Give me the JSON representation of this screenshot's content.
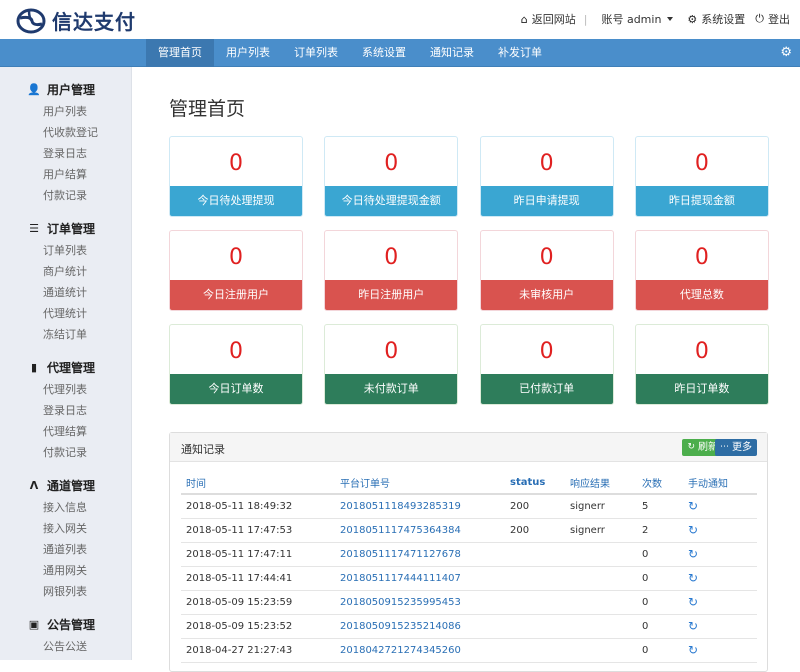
{
  "header": {
    "brand": "信达支付",
    "home_link": "返回网站",
    "account_label": "账号 admin",
    "settings_link": "系统设置",
    "logout_link": "登出"
  },
  "nav": {
    "items": [
      {
        "label": "管理首页",
        "active": true
      },
      {
        "label": "用户列表",
        "active": false
      },
      {
        "label": "订单列表",
        "active": false
      },
      {
        "label": "系统设置",
        "active": false
      },
      {
        "label": "通知记录",
        "active": false
      },
      {
        "label": "补发订单",
        "active": false
      }
    ]
  },
  "sidebar": {
    "groups": [
      {
        "title": "用户管理",
        "icon": "user-icon",
        "items": [
          "用户列表",
          "代收款登记",
          "登录日志",
          "用户结算",
          "付款记录"
        ]
      },
      {
        "title": "订单管理",
        "icon": "list-icon",
        "items": [
          "订单列表",
          "商户统计",
          "通道统计",
          "代理统计",
          "冻结订单"
        ]
      },
      {
        "title": "代理管理",
        "icon": "file-icon",
        "items": [
          "代理列表",
          "登录日志",
          "代理结算",
          "付款记录"
        ]
      },
      {
        "title": "通道管理",
        "icon": "road-icon",
        "items": [
          "接入信息",
          "接入网关",
          "通道列表",
          "通用网关",
          "网银列表"
        ]
      },
      {
        "title": "公告管理",
        "icon": "notice-icon",
        "items": [
          "公告公送"
        ]
      }
    ]
  },
  "main": {
    "title": "管理首页",
    "colors": {
      "blue": "#3aa6d2",
      "red": "#d9534f",
      "green": "#2e7d5b",
      "number": "#e02020"
    },
    "cards": [
      {
        "value": "0",
        "label": "今日待处理提现",
        "color": "blue"
      },
      {
        "value": "0",
        "label": "今日待处理提现金额",
        "color": "blue"
      },
      {
        "value": "0",
        "label": "昨日申请提现",
        "color": "blue"
      },
      {
        "value": "0",
        "label": "昨日提现金额",
        "color": "blue"
      },
      {
        "value": "0",
        "label": "今日注册用户",
        "color": "red"
      },
      {
        "value": "0",
        "label": "昨日注册用户",
        "color": "red"
      },
      {
        "value": "0",
        "label": "未审核用户",
        "color": "red"
      },
      {
        "value": "0",
        "label": "代理总数",
        "color": "red"
      },
      {
        "value": "0",
        "label": "今日订单数",
        "color": "green"
      },
      {
        "value": "0",
        "label": "未付款订单",
        "color": "green"
      },
      {
        "value": "0",
        "label": "已付款订单",
        "color": "green"
      },
      {
        "value": "0",
        "label": "昨日订单数",
        "color": "green"
      }
    ]
  },
  "notify": {
    "title": "通知记录",
    "refresh_label": "刷新",
    "more_label": "更多",
    "columns": [
      "时间",
      "平台订单号",
      "status",
      "响应结果",
      "次数",
      "手动通知"
    ],
    "rows": [
      {
        "time": "2018-05-11 18:49:32",
        "order": "2018051118493285319",
        "status": "200",
        "result": "signerr",
        "count": "5"
      },
      {
        "time": "2018-05-11 17:47:53",
        "order": "2018051117475364384",
        "status": "200",
        "result": "signerr",
        "count": "2"
      },
      {
        "time": "2018-05-11 17:47:11",
        "order": "2018051117471127678",
        "status": "",
        "result": "",
        "count": "0"
      },
      {
        "time": "2018-05-11 17:44:41",
        "order": "2018051117444111407",
        "status": "",
        "result": "",
        "count": "0"
      },
      {
        "time": "2018-05-09 15:23:59",
        "order": "2018050915235995453",
        "status": "",
        "result": "",
        "count": "0"
      },
      {
        "time": "2018-05-09 15:23:52",
        "order": "2018050915235214086",
        "status": "",
        "result": "",
        "count": "0"
      },
      {
        "time": "2018-04-27 21:27:43",
        "order": "2018042721274345260",
        "status": "",
        "result": "",
        "count": "0"
      }
    ]
  }
}
